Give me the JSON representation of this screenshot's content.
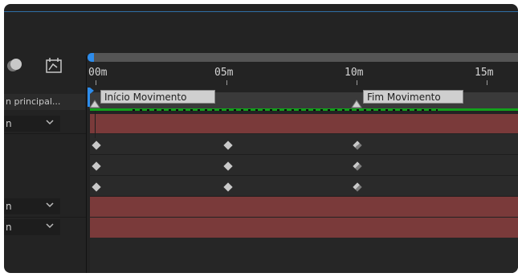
{
  "header": {
    "icons": [
      "motion-blur-icon",
      "graph-editor-icon"
    ]
  },
  "timeline": {
    "ruler_labels": [
      "00m",
      "05m",
      "10m",
      "15m"
    ],
    "markers": [
      {
        "label": "Início Movimento"
      },
      {
        "label": "Fim Movimento"
      }
    ],
    "current_time_indicator_color": "#2d8ceb",
    "work_area_color": "#12a11b",
    "layer_bar_color": "#7a3a3a"
  },
  "left_panel": {
    "comp_label": "n principal...",
    "rows": [
      {
        "value": "n",
        "has_dropdown": true
      },
      {
        "value": "",
        "has_dropdown": false
      },
      {
        "value": "",
        "has_dropdown": false
      },
      {
        "value": "",
        "has_dropdown": false
      },
      {
        "value": "n",
        "has_dropdown": true
      },
      {
        "value": "n",
        "has_dropdown": true
      }
    ]
  }
}
